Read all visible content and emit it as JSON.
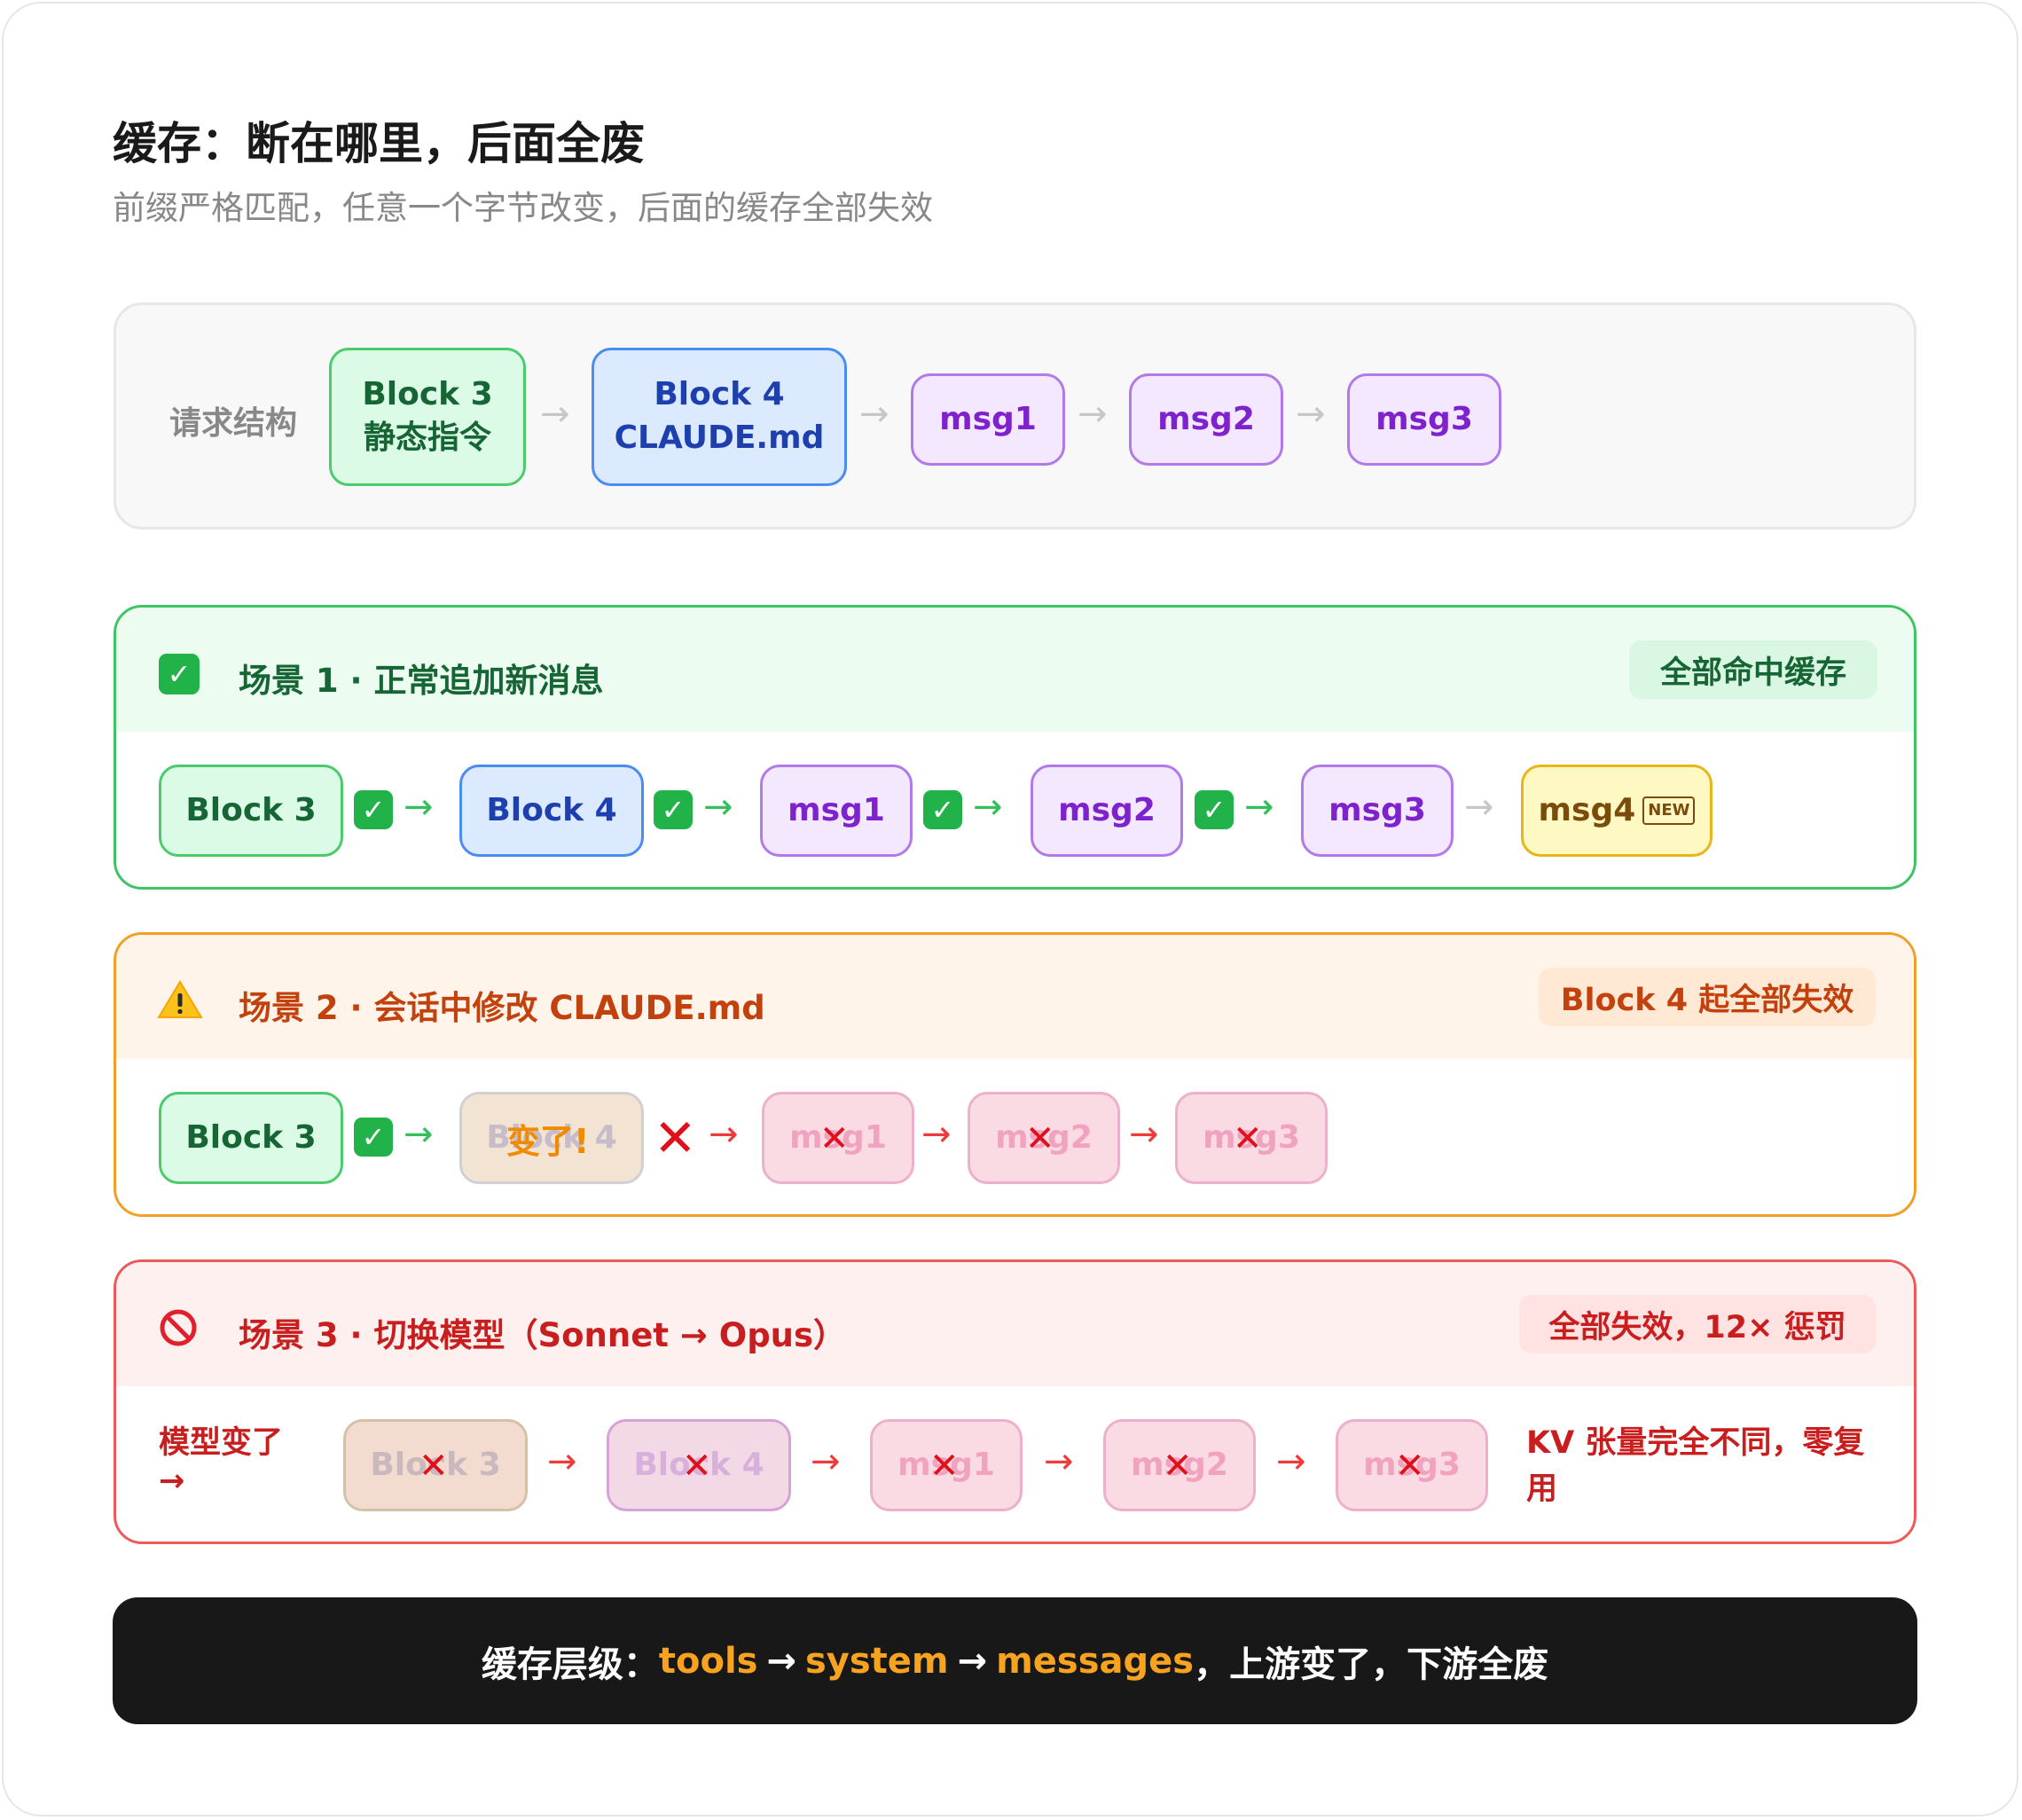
{
  "title": "缓存：断在哪里，后面全废",
  "subtitle": "前缀严格匹配，任意一个字节改变，后面的缓存全部失效",
  "structure": {
    "label": "请求结构",
    "block3_line1": "Block 3",
    "block3_line2": "静态指令",
    "block4_line1": "Block 4",
    "block4_line2": "CLAUDE.md",
    "msg1": "msg1",
    "msg2": "msg2",
    "msg3": "msg3"
  },
  "scene1": {
    "icon": "check-mark-button-icon",
    "title": "场景 1 · 正常追加新消息",
    "badge": "全部命中缓存",
    "block3": "Block 3",
    "block4": "Block 4",
    "msg1": "msg1",
    "msg2": "msg2",
    "msg3": "msg3",
    "msg4": "msg4",
    "new_badge": "NEW"
  },
  "scene2": {
    "icon": "warning-icon",
    "title": "场景 2 · 会话中修改 CLAUDE.md",
    "badge": "Block 4 起全部失效",
    "block3": "Block 3",
    "block4": "Block 4",
    "changed": "变了!",
    "msg1": "msg1",
    "msg2": "msg2",
    "msg3": "msg3"
  },
  "scene3": {
    "icon": "prohibited-icon",
    "title": "场景 3 · 切换模型（Sonnet → Opus）",
    "badge": "全部失效，12× 惩罚",
    "left_line1": "模型变了",
    "left_line2": "→",
    "block3": "Block 3",
    "block4": "Block 4",
    "msg1": "msg1",
    "msg2": "msg2",
    "msg3": "msg3",
    "right_line1": "KV 张量完全不同，零复",
    "right_line2": "用"
  },
  "footer": {
    "prefix": "缓存层级：",
    "tools": "tools",
    "system": "system",
    "messages": "messages",
    "suffix": "，上游变了，下游全废"
  },
  "colors": {
    "hit_green": "#21b34a",
    "warn_orange": "#f29f27",
    "fail_red": "#ec5a5a",
    "highlight": "#f7a320"
  }
}
